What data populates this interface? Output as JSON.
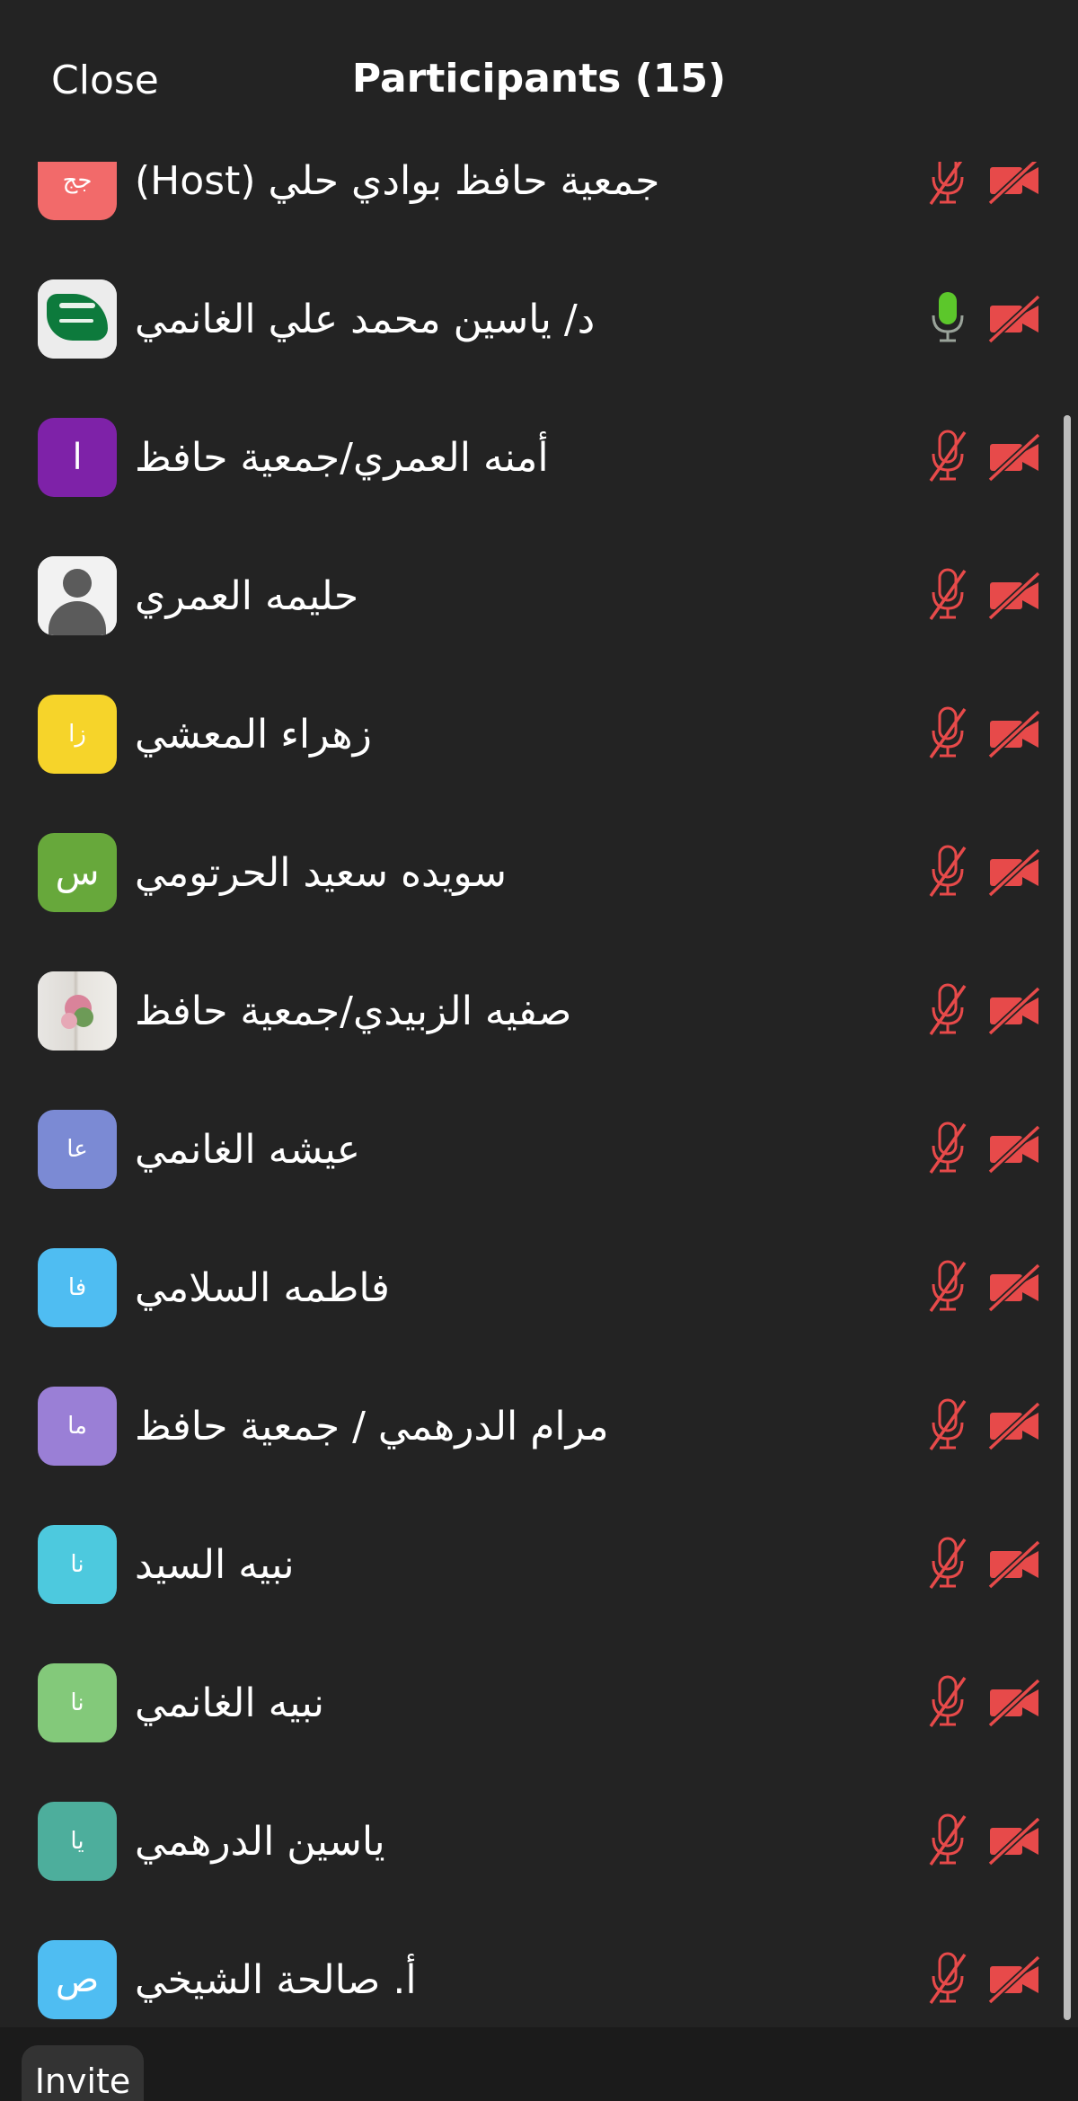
{
  "header": {
    "close_label": "Close",
    "title": "Participants (15)"
  },
  "footer": {
    "invite_label": "Invite"
  },
  "colors": {
    "background": "#232323",
    "muted_red": "#e74a4a",
    "mic_active_green": "#5cc72b"
  },
  "participants": [
    {
      "name": "جمعية حافظ بوادي حلي (Host)",
      "avatar_text": "جج",
      "avatar_color": "#f26a6a",
      "avatar_kind": "initials",
      "mic": "muted",
      "video": "off"
    },
    {
      "name": "د/ ياسين محمد  علي الغانمي",
      "avatar_text": "",
      "avatar_color": "#ececec",
      "avatar_kind": "flag-image",
      "mic": "active",
      "video": "off"
    },
    {
      "name": "أمنه العمري/جمعية حافظ",
      "avatar_text": "ا",
      "avatar_color": "#7e22a8",
      "avatar_kind": "initials",
      "mic": "muted",
      "video": "off"
    },
    {
      "name": "حليمه العمري",
      "avatar_text": "",
      "avatar_color": "#f2f2f2",
      "avatar_kind": "person-placeholder",
      "mic": "muted",
      "video": "off"
    },
    {
      "name": "زهراء المعشي",
      "avatar_text": "زا",
      "avatar_color": "#f6d42a",
      "avatar_kind": "initials",
      "mic": "muted",
      "video": "off"
    },
    {
      "name": "سويده سعيد الحرتومي",
      "avatar_text": "س",
      "avatar_color": "#67a83b",
      "avatar_kind": "initials",
      "mic": "muted",
      "video": "off"
    },
    {
      "name": "صفيه الزبيدي/جمعية حافظ",
      "avatar_text": "",
      "avatar_color": "#e6e3de",
      "avatar_kind": "photo",
      "mic": "muted",
      "video": "off"
    },
    {
      "name": "عيشه الغانمي",
      "avatar_text": "عا",
      "avatar_color": "#7b8ad4",
      "avatar_kind": "initials",
      "mic": "muted",
      "video": "off"
    },
    {
      "name": "فاطمه السلامي",
      "avatar_text": "فا",
      "avatar_color": "#4fbdf2",
      "avatar_kind": "initials",
      "mic": "muted",
      "video": "off"
    },
    {
      "name": "مرام الدرهمي / جمعية حافظ",
      "avatar_text": "ما",
      "avatar_color": "#9a7fd6",
      "avatar_kind": "initials",
      "mic": "muted",
      "video": "off"
    },
    {
      "name": "نبيه السيد",
      "avatar_text": "نا",
      "avatar_color": "#4dc9de",
      "avatar_kind": "initials",
      "mic": "muted",
      "video": "off"
    },
    {
      "name": "نبيه الغانمي",
      "avatar_text": "نا",
      "avatar_color": "#83c97a",
      "avatar_kind": "initials",
      "mic": "muted",
      "video": "off"
    },
    {
      "name": "ياسين الدرهمي",
      "avatar_text": "يا",
      "avatar_color": "#4dae9c",
      "avatar_kind": "initials",
      "mic": "muted",
      "video": "off"
    },
    {
      "name": "أ. صالحة الشيخي",
      "avatar_text": "ص",
      "avatar_color": "#4fbdf2",
      "avatar_kind": "initials",
      "mic": "muted",
      "video": "off"
    }
  ]
}
